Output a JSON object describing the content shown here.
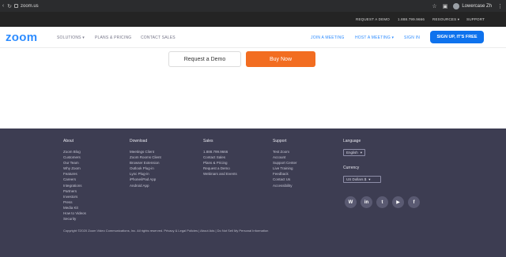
{
  "browser": {
    "back_icon": "back-arrow-icon",
    "reload_icon": "reload-icon",
    "url": "zoom.us",
    "user_name": "Lowercase Zh"
  },
  "utility_bar": {
    "items": [
      "REQUEST A DEMO",
      "1.888.799.9666",
      "RESOURCES ▾",
      "SUPPORT"
    ]
  },
  "nav": {
    "logo": "zoom",
    "links": [
      "SOLUTIONS ▾",
      "PLANS & PRICING",
      "CONTACT SALES"
    ],
    "right_links": [
      "JOIN A MEETING",
      "HOST A MEETING ▾",
      "SIGN IN"
    ],
    "signup": "SIGN UP, IT'S FREE"
  },
  "hero": {
    "request_demo": "Request a Demo",
    "buy_now": "Buy Now"
  },
  "footer": {
    "about": {
      "heading": "About",
      "items": [
        "Zoom Blog",
        "Customers",
        "Our Team",
        "Why Zoom",
        "Features",
        "Careers",
        "Integrations",
        "Partners",
        "Investors",
        "Press",
        "Media Kit",
        "How to Videos",
        "Security"
      ]
    },
    "download": {
      "heading": "Download",
      "items": [
        "Meetings Client",
        "Zoom Rooms Client",
        "Browser Extension",
        "Outlook Plug-in",
        "Lync Plug-in",
        "iPhone/iPad App",
        "Android App"
      ]
    },
    "sales": {
      "heading": "Sales",
      "items": [
        "1.888.799.9666",
        "Contact Sales",
        "Plans & Pricing",
        "Request a Demo",
        "Webinars and Events"
      ]
    },
    "support": {
      "heading": "Support",
      "items": [
        "Test Zoom",
        "Account",
        "Support Center",
        "Live Training",
        "Feedback",
        "Contact Us",
        "Accessibility"
      ]
    },
    "language": {
      "heading": "Language",
      "value": "English"
    },
    "currency": {
      "heading": "Currency",
      "value": "US Dollars $"
    },
    "social": [
      "W",
      "in",
      "t",
      "▶",
      "f"
    ],
    "copyright": "Copyright ©2020 Zoom Video Communications, Inc. All rights reserved.   Privacy & Legal Policies   |   About Ads   |   Do Not Sell My Personal Information"
  }
}
